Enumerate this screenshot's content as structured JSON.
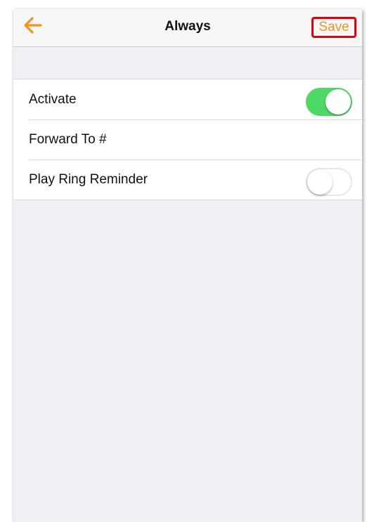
{
  "colors": {
    "accent": "#f0931f",
    "highlight_border": "#e0000f",
    "toggle_on": "#4cd964"
  },
  "navbar": {
    "back_icon": "arrow-left-icon",
    "title": "Always",
    "save_label": "Save"
  },
  "settings": {
    "rows": [
      {
        "label": "Activate",
        "toggle": "on"
      },
      {
        "label": "Forward To #"
      },
      {
        "label": "Play Ring Reminder",
        "toggle": "off"
      }
    ]
  }
}
